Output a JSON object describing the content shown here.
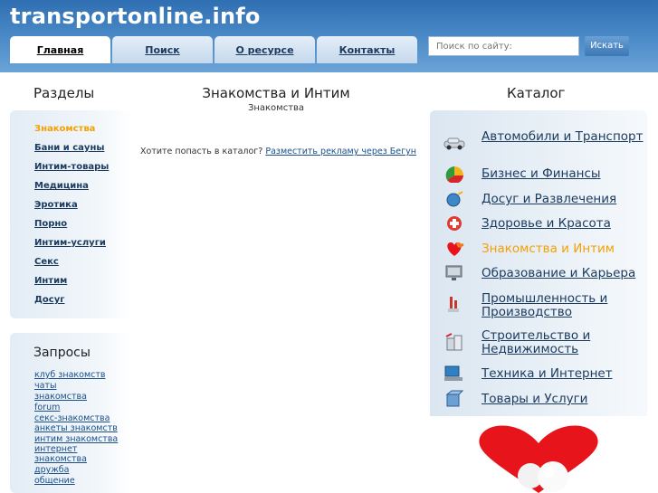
{
  "header": {
    "site_title": "transportonline.info",
    "tabs": [
      {
        "label": "Главная",
        "active": true
      },
      {
        "label": "Поиск"
      },
      {
        "label": "О ресурсе"
      },
      {
        "label": "Контакты"
      }
    ],
    "search_placeholder": "Поиск по сайту:",
    "search_button": "Искать"
  },
  "left": {
    "sections_title": "Разделы",
    "categories": [
      "Знакомства",
      "Бани и сауны",
      "Интим-товары",
      "Медицина",
      "Эротика",
      "Порно",
      "Интим-услуги",
      "Секс",
      "Интим",
      "Досуг"
    ],
    "active_category": "Знакомства",
    "queries_title": "Запросы",
    "queries": [
      "клуб знакомств",
      "чаты",
      "знакомства",
      "forum",
      "секс-знакомства",
      "анкеты знакомств",
      "интим знакомства",
      "интернет знакомства",
      "дружба",
      "общение"
    ]
  },
  "middle": {
    "title": "Знакомства и Интим",
    "subtitle": "Знакомства",
    "ad_text": "Хотите попасть в каталог?",
    "ad_link": "Разместить рекламу через Бегун"
  },
  "right": {
    "catalog_title": "Каталог",
    "items": [
      {
        "label": "Автомобили и Транспорт",
        "icon": "car-icon"
      },
      {
        "label": "Бизнес и Финансы",
        "icon": "chart-icon"
      },
      {
        "label": "Досуг и Развлечения",
        "icon": "globe-icon"
      },
      {
        "label": "Здоровье и Красота",
        "icon": "health-icon"
      },
      {
        "label": "Знакомства и Интим",
        "icon": "hearts-icon",
        "active": true
      },
      {
        "label": "Образование и Карьера",
        "icon": "monitor-icon"
      },
      {
        "label": "Промышленность и Производство",
        "icon": "factory-icon"
      },
      {
        "label": "Строительство и Недвижимость",
        "icon": "building-icon"
      },
      {
        "label": "Техника и Интернет",
        "icon": "computer-icon"
      },
      {
        "label": "Товары и Услуги",
        "icon": "goods-icon"
      }
    ]
  },
  "colors": {
    "header_blue": "#2f6fb2",
    "link": "#1a3a5e",
    "active": "#f5a000",
    "heart": "#e8141b"
  }
}
